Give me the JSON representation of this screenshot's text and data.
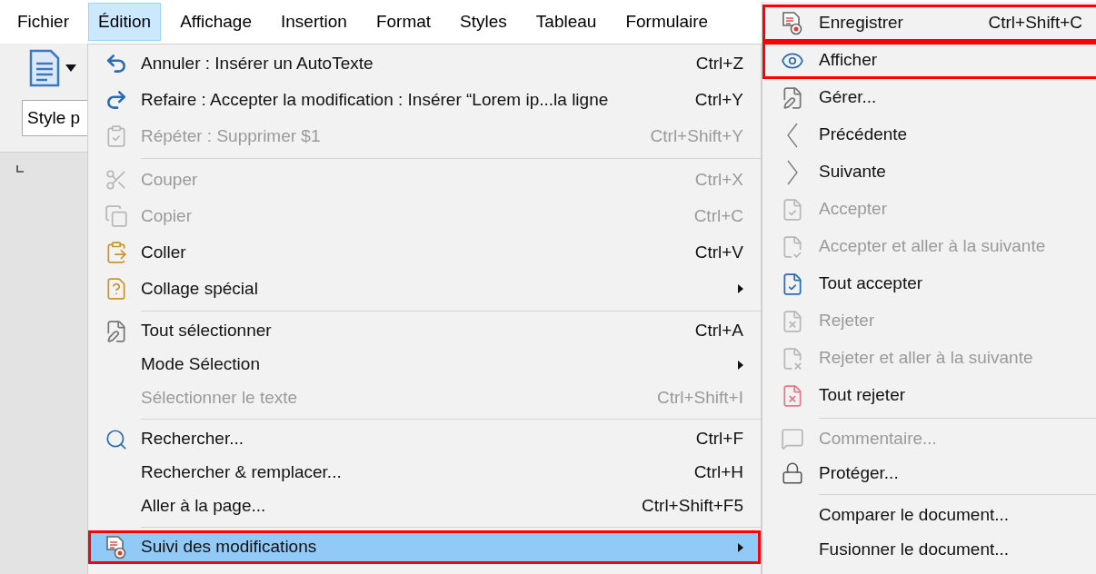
{
  "menubar": [
    {
      "label": "Fichier",
      "selected": false
    },
    {
      "label": "Édition",
      "selected": true
    },
    {
      "label": "Affichage",
      "selected": false
    },
    {
      "label": "Insertion",
      "selected": false
    },
    {
      "label": "Format",
      "selected": false
    },
    {
      "label": "Styles",
      "selected": false
    },
    {
      "label": "Tableau",
      "selected": false
    },
    {
      "label": "Formulaire",
      "selected": false
    }
  ],
  "toolbar": {
    "style_field": "Style p"
  },
  "edit_menu": [
    {
      "kind": "item",
      "label": "Annuler : Insérer un AutoTexte",
      "shortcut": "Ctrl+Z",
      "disabled": false,
      "has_submenu": false,
      "selected": false,
      "highlighted": false
    },
    {
      "kind": "item",
      "label": "Refaire : Accepter la modification : Insérer “Lorem ip...la ligne",
      "shortcut": "Ctrl+Y",
      "disabled": false,
      "has_submenu": false,
      "selected": false,
      "highlighted": false
    },
    {
      "kind": "item",
      "label": "Répéter : Supprimer $1",
      "shortcut": "Ctrl+Shift+Y",
      "disabled": true,
      "has_submenu": false,
      "selected": false,
      "highlighted": false
    },
    {
      "kind": "separator"
    },
    {
      "kind": "item",
      "label": "Couper",
      "shortcut": "Ctrl+X",
      "disabled": true,
      "has_submenu": false,
      "selected": false,
      "highlighted": false
    },
    {
      "kind": "item",
      "label": "Copier",
      "shortcut": "Ctrl+C",
      "disabled": true,
      "has_submenu": false,
      "selected": false,
      "highlighted": false
    },
    {
      "kind": "item",
      "label": "Coller",
      "shortcut": "Ctrl+V",
      "disabled": false,
      "has_submenu": false,
      "selected": false,
      "highlighted": false
    },
    {
      "kind": "item",
      "label": "Collage spécial",
      "disabled": false,
      "has_submenu": true,
      "selected": false,
      "highlighted": false
    },
    {
      "kind": "separator"
    },
    {
      "kind": "item",
      "label": "Tout sélectionner",
      "shortcut": "Ctrl+A",
      "disabled": false,
      "has_submenu": false,
      "selected": false,
      "highlighted": false
    },
    {
      "kind": "item",
      "label": "Mode Sélection",
      "disabled": false,
      "has_submenu": true,
      "selected": false,
      "highlighted": false
    },
    {
      "kind": "item",
      "label": "Sélectionner le texte",
      "shortcut": "Ctrl+Shift+I",
      "disabled": true,
      "has_submenu": false,
      "selected": false,
      "highlighted": false
    },
    {
      "kind": "separator"
    },
    {
      "kind": "item",
      "label": "Rechercher...",
      "shortcut": "Ctrl+F",
      "disabled": false,
      "has_submenu": false,
      "selected": false,
      "highlighted": false
    },
    {
      "kind": "item",
      "label": "Rechercher & remplacer...",
      "shortcut": "Ctrl+H",
      "disabled": false,
      "has_submenu": false,
      "selected": false,
      "highlighted": false
    },
    {
      "kind": "item",
      "label": "Aller à la page...",
      "shortcut": "Ctrl+Shift+F5",
      "disabled": false,
      "has_submenu": false,
      "selected": false,
      "highlighted": false
    },
    {
      "kind": "separator"
    },
    {
      "kind": "item",
      "label": "Suivi des modifications",
      "disabled": false,
      "has_submenu": true,
      "selected": true,
      "highlighted": true
    }
  ],
  "track_changes_menu": [
    {
      "kind": "item",
      "label": "Enregistrer",
      "shortcut": "Ctrl+Shift+C",
      "disabled": false,
      "selected": false,
      "highlighted": true
    },
    {
      "kind": "item",
      "label": "Afficher",
      "disabled": false,
      "selected": false,
      "highlighted": true
    },
    {
      "kind": "item",
      "label": "Gérer...",
      "disabled": false,
      "selected": false,
      "highlighted": false
    },
    {
      "kind": "item",
      "label": "Précédente",
      "disabled": false,
      "selected": false,
      "highlighted": false
    },
    {
      "kind": "item",
      "label": "Suivante",
      "disabled": false,
      "selected": false,
      "highlighted": false
    },
    {
      "kind": "item",
      "label": "Accepter",
      "disabled": true,
      "selected": false,
      "highlighted": false
    },
    {
      "kind": "item",
      "label": "Accepter et aller à la suivante",
      "disabled": true,
      "selected": false,
      "highlighted": false
    },
    {
      "kind": "item",
      "label": "Tout accepter",
      "disabled": false,
      "selected": false,
      "highlighted": false
    },
    {
      "kind": "item",
      "label": "Rejeter",
      "disabled": true,
      "selected": false,
      "highlighted": false
    },
    {
      "kind": "item",
      "label": "Rejeter et aller à la suivante",
      "disabled": true,
      "selected": false,
      "highlighted": false
    },
    {
      "kind": "item",
      "label": "Tout rejeter",
      "disabled": false,
      "selected": false,
      "highlighted": false
    },
    {
      "kind": "separator"
    },
    {
      "kind": "item",
      "label": "Commentaire...",
      "disabled": true,
      "selected": false,
      "highlighted": false
    },
    {
      "kind": "item",
      "label": "Protéger...",
      "disabled": false,
      "selected": false,
      "highlighted": false
    },
    {
      "kind": "separator"
    },
    {
      "kind": "item",
      "label": "Comparer le document...",
      "disabled": false,
      "selected": false,
      "highlighted": false
    },
    {
      "kind": "item",
      "label": "Fusionner le document...",
      "disabled": false,
      "selected": false,
      "highlighted": false
    }
  ]
}
